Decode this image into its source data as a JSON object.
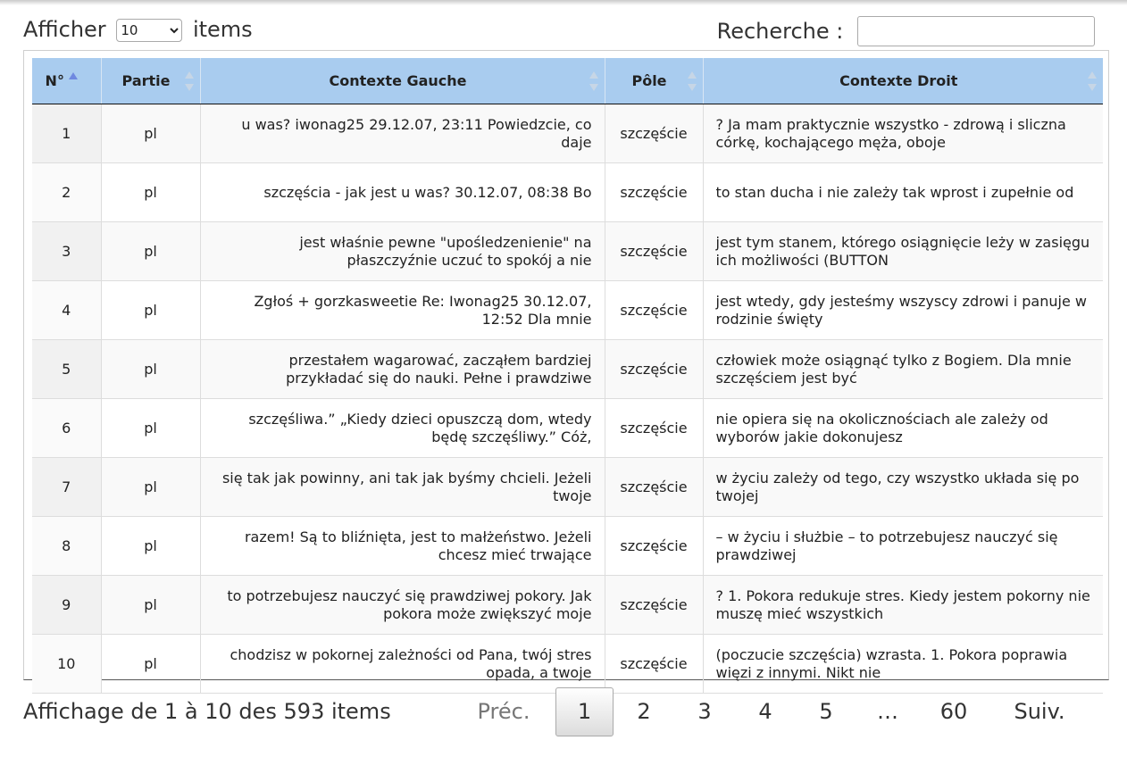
{
  "length": {
    "label_before": "Afficher",
    "value": "10",
    "options": [
      "10"
    ],
    "label_after": "items"
  },
  "search": {
    "label": "Recherche :",
    "value": ""
  },
  "table": {
    "headers": [
      "N°",
      "Partie",
      "Contexte Gauche",
      "Pôle",
      "Contexte Droit"
    ],
    "rows": [
      [
        "1",
        "pl",
        "u was? iwonag25 29.12.07, 23:11 Powiedzcie, co daje",
        "szczęście",
        "? Ja mam praktycznie wszystko - zdrową i sliczna córkę, kochającego męża, oboje"
      ],
      [
        "2",
        "pl",
        "szczęścia - jak jest u was? 30.12.07, 08:38 Bo",
        "szczęście",
        "to stan ducha i nie zależy tak wprost i zupełnie od"
      ],
      [
        "3",
        "pl",
        "jest właśnie pewne \"upośledzenienie\" na płaszczyźnie uczuć to spokój a nie",
        "szczęście",
        "jest tym stanem, którego osiągnięcie leży w zasięgu ich możliwości (BUTTON"
      ],
      [
        "4",
        "pl",
        "Zgłoś + gorzkasweetie Re: Iwonag25 30.12.07, 12:52 Dla mnie",
        "szczęście",
        "jest wtedy, gdy jesteśmy wszyscy zdrowi i panuje w rodzinie święty"
      ],
      [
        "5",
        "pl",
        "przestałem wagarować, zacząłem bardziej przykładać się do nauki. Pełne i prawdziwe",
        "szczęście",
        "człowiek może osiągnąć tylko z Bogiem. Dla mnie szczęściem jest być"
      ],
      [
        "6",
        "pl",
        "szczęśliwa.” „Kiedy dzieci opuszczą dom, wtedy będę szczęśliwy.” Cóż,",
        "szczęście",
        "nie opiera się na okolicznościach ale zależy od wyborów jakie dokonujesz"
      ],
      [
        "7",
        "pl",
        "się tak jak powinny, ani tak jak byśmy chcieli. Jeżeli twoje",
        "szczęście",
        "w życiu zależy od tego, czy wszystko układa się po twojej"
      ],
      [
        "8",
        "pl",
        "razem! Są to bliźnięta, jest to małżeństwo. Jeżeli chcesz mieć trwające",
        "szczęście",
        "– w życiu i służbie – to potrzebujesz nauczyć się prawdziwej"
      ],
      [
        "9",
        "pl",
        "to potrzebujesz nauczyć się prawdziwej pokory. Jak pokora może zwiększyć moje",
        "szczęście",
        "? 1. Pokora redukuje stres. Kiedy jestem pokorny nie muszę mieć wszystkich"
      ],
      [
        "10",
        "pl",
        "chodzisz w pokornej zależności od Pana, twój stres opada, a twoje",
        "szczęście",
        "(poczucie szczęścia) wzrasta. 1. Pokora poprawia więzi z innymi. Nikt nie"
      ]
    ]
  },
  "info": "Affichage de 1 à 10 des 593 items",
  "pagination": {
    "prev": "Préc.",
    "pages": [
      "1",
      "2",
      "3",
      "4",
      "5",
      "…",
      "60"
    ],
    "current": "1",
    "next": "Suiv."
  },
  "colors": {
    "header_bg": "#a9ccef",
    "sort_active": "#6f88e0",
    "odd_row": "#f9f9f9"
  }
}
